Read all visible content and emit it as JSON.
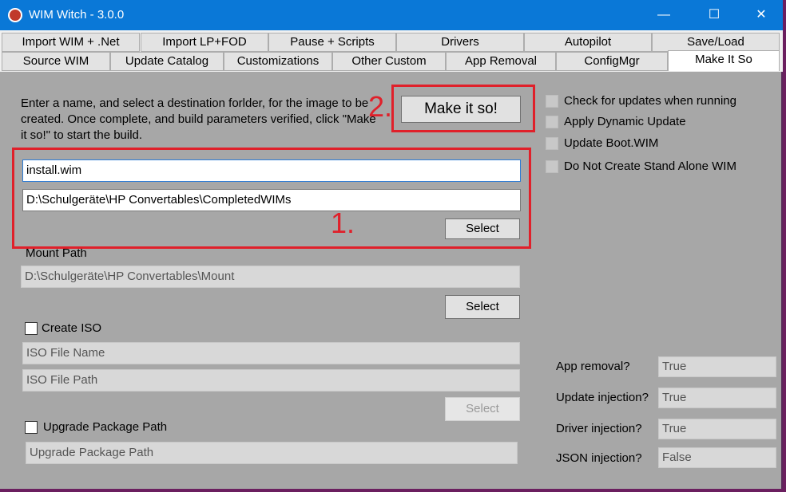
{
  "window": {
    "title": "WIM Witch - 3.0.0",
    "controls": {
      "minimize": "—",
      "maximize": "☐",
      "close": "✕"
    }
  },
  "tabs_row1": [
    "Import WIM + .Net",
    "Import LP+FOD",
    "Pause + Scripts",
    "Drivers",
    "Autopilot",
    "Save/Load"
  ],
  "tabs_row2": [
    "Source WIM",
    "Update Catalog",
    "Customizations",
    "Other Custom",
    "App Removal",
    "ConfigMgr",
    "Make It So"
  ],
  "instructions": "Enter a name, and select a destination forlder, for the  image to be created. Once complete, and build parameters verified, click \"Make it so!\" to start the build.",
  "make_it_so_button": "Make it so!",
  "wim_name": "install.wim",
  "destination_path": "D:\\Schulgeräte\\HP Convertables\\CompletedWIMs",
  "select_label": "Select",
  "mount_path_label": "Mount Path",
  "mount_path": "D:\\Schulgeräte\\HP Convertables\\Mount",
  "create_iso_label": "Create ISO",
  "iso_file_name": "ISO File Name",
  "iso_file_path": "ISO File Path",
  "upgrade_package_label": "Upgrade Package Path",
  "upgrade_package_path": "Upgrade Package Path",
  "options": [
    "Check for updates when running",
    "Apply Dynamic Update",
    "Update Boot.WIM",
    "Do Not Create Stand Alone WIM"
  ],
  "summary": [
    {
      "label": "App removal?",
      "value": "True"
    },
    {
      "label": "Update injection?",
      "value": "True"
    },
    {
      "label": "Driver injection?",
      "value": "True"
    },
    {
      "label": "JSON injection?",
      "value": "False"
    }
  ],
  "annotations": {
    "one": "1.",
    "two": "2."
  },
  "colors": {
    "titlebar": "#0a78d7",
    "panel": "#a7a7a7",
    "annotation": "#e0202a"
  }
}
